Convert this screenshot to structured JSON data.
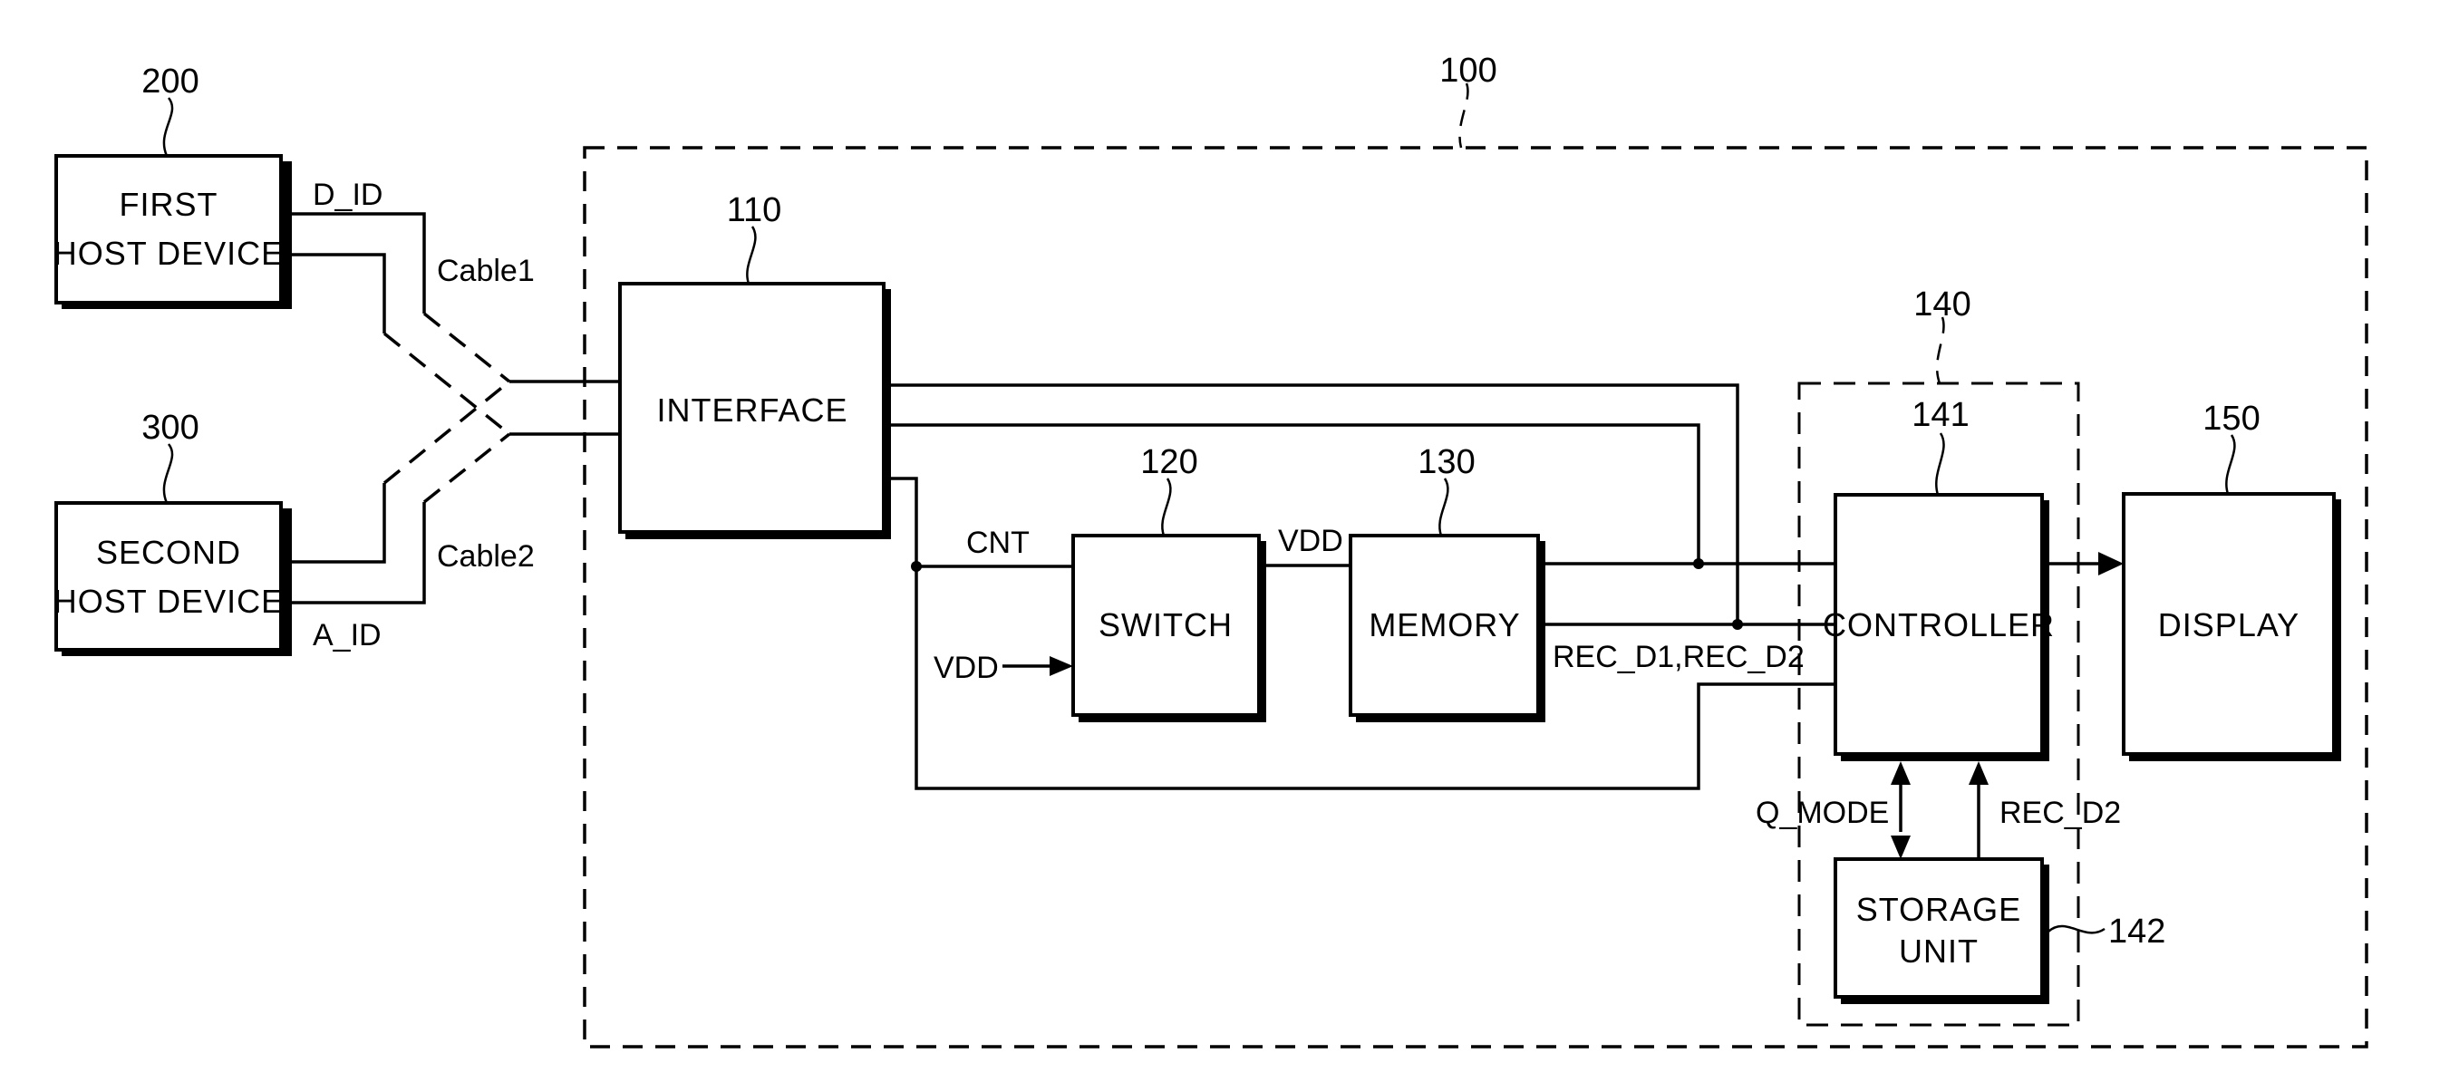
{
  "figure": {
    "reference_numerals": {
      "device": "100",
      "interface": "110",
      "switch": "120",
      "memory": "130",
      "controller_group": "140",
      "controller": "141",
      "storage_unit": "142",
      "display": "150",
      "first_host": "200",
      "second_host": "300"
    },
    "blocks": {
      "first_host": {
        "line1": "FIRST",
        "line2": "HOST DEVICE"
      },
      "second_host": {
        "line1": "SECOND",
        "line2": "HOST DEVICE"
      },
      "interface": "INTERFACE",
      "switch": "SWITCH",
      "memory": "MEMORY",
      "controller": "CONTROLLER",
      "display": "DISPLAY",
      "storage_unit": {
        "line1": "STORAGE",
        "line2": "UNIT"
      }
    },
    "signals": {
      "d_id": "D_ID",
      "a_id": "A_ID",
      "cable1": "Cable1",
      "cable2": "Cable2",
      "cnt": "CNT",
      "vdd_in": "VDD",
      "vdd_out": "VDD",
      "rec_d1_d2": "REC_D1,REC_D2",
      "q_mode": "Q_MODE",
      "rec_d2": "REC_D2"
    }
  }
}
